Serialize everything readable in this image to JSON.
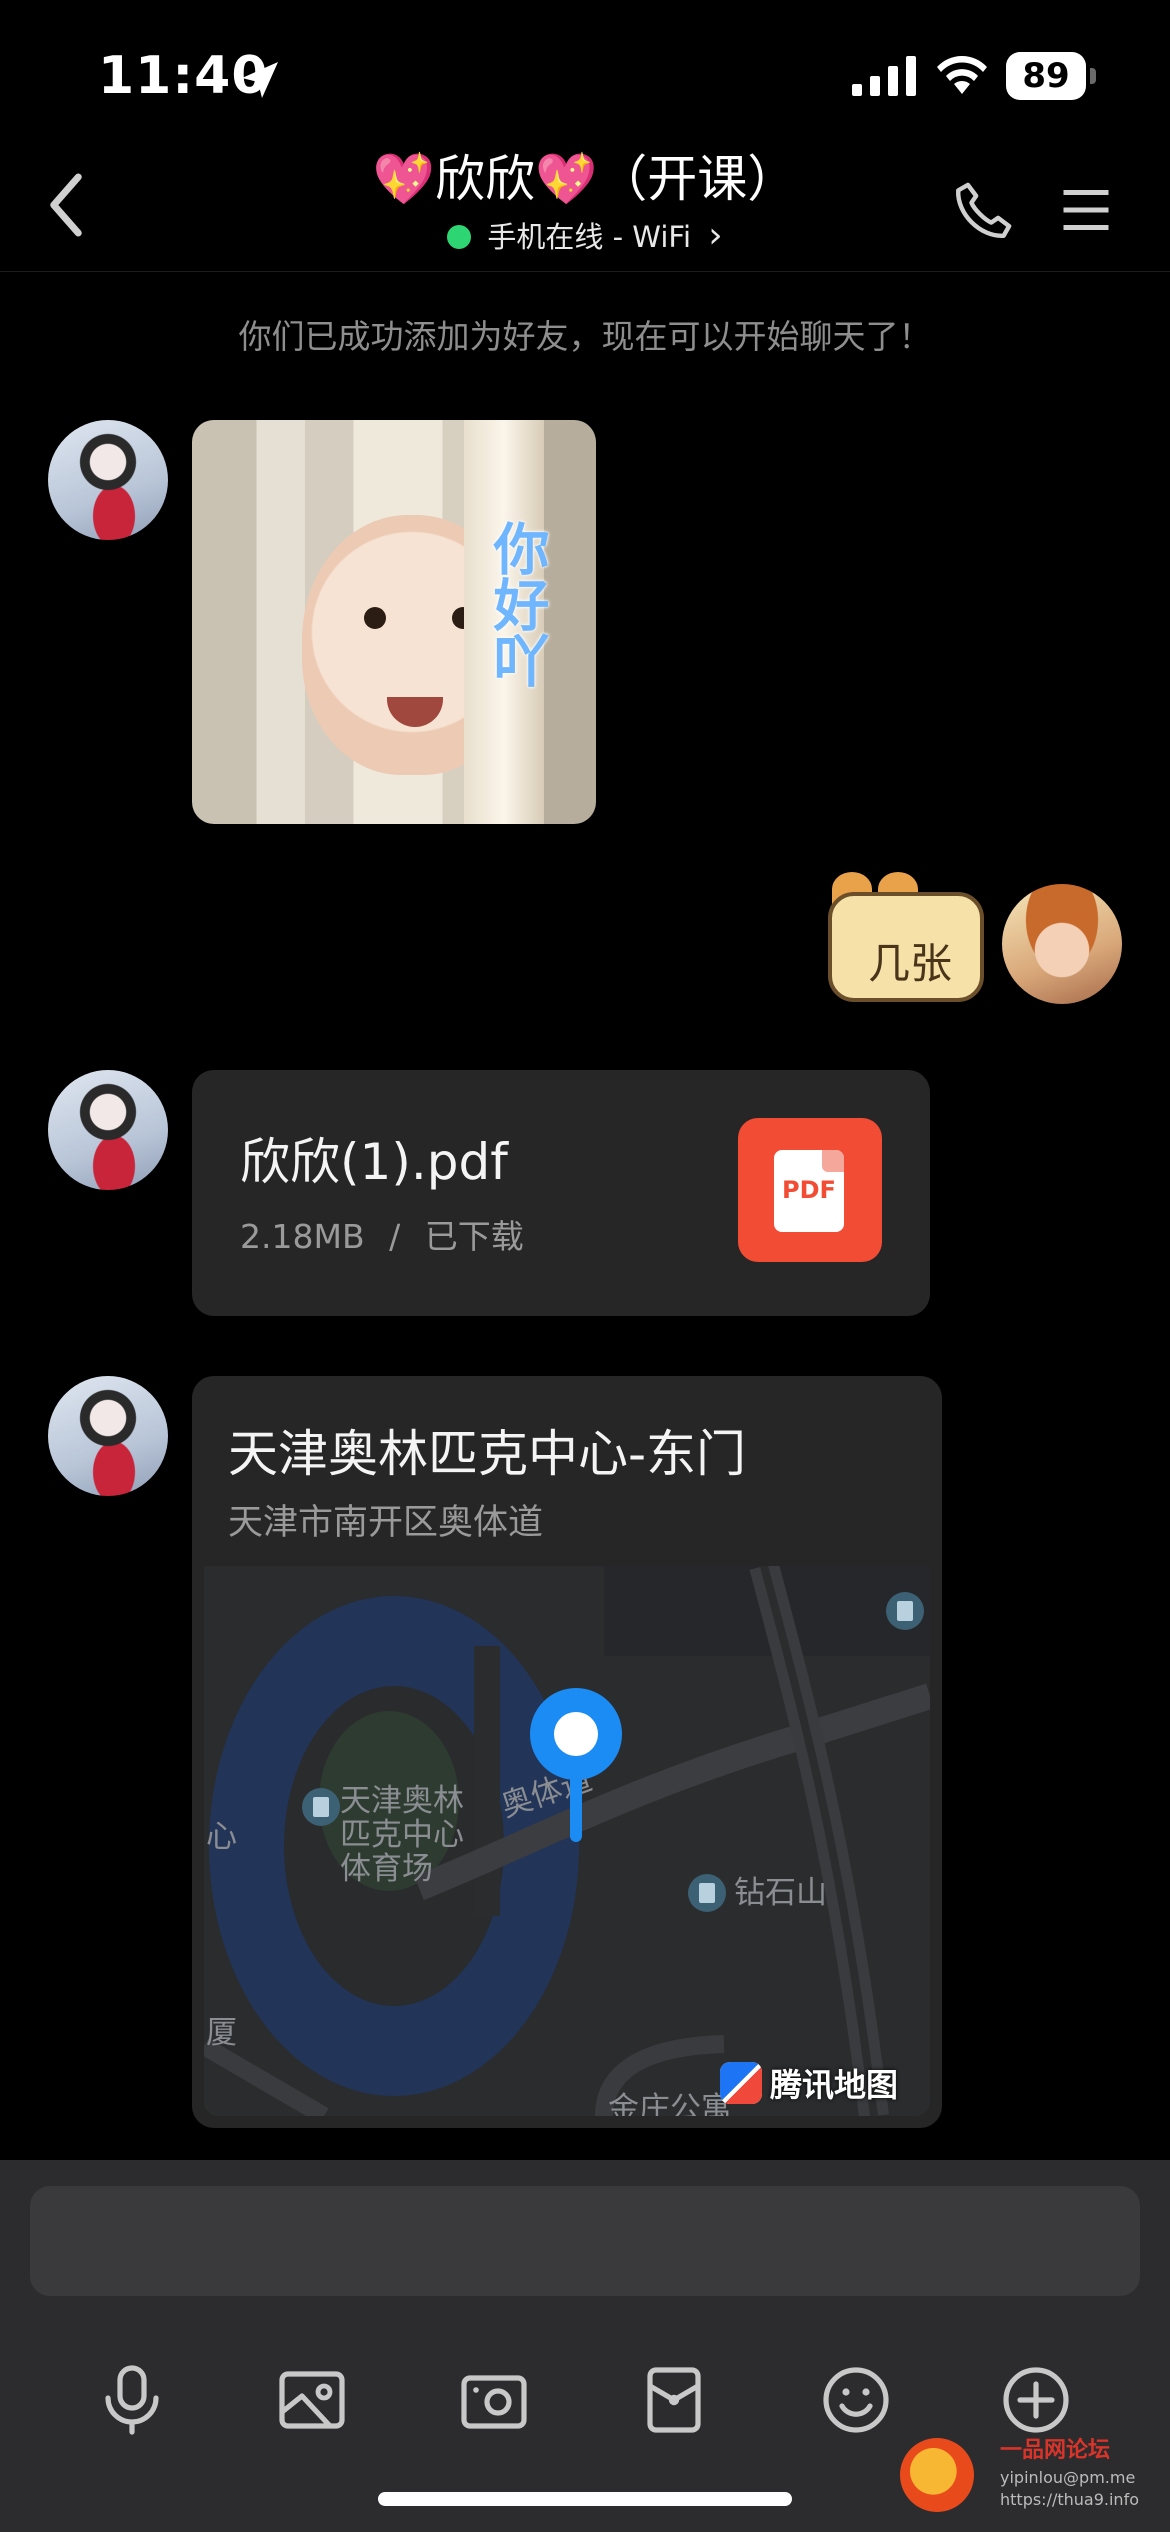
{
  "status_bar": {
    "time": "11:40",
    "battery": "89"
  },
  "header": {
    "title": "💖欣欣💖（开课）",
    "status": "手机在线 - WiFi",
    "status_chevron": "›",
    "online_color": "#2ed573"
  },
  "chat": {
    "system_note": "你们已成功添加为好友，现在可以开始聊天了！",
    "sticker_text": "你好吖",
    "cat_sticker_text": "几张",
    "file": {
      "name": "欣欣(1).pdf",
      "size": "2.18MB",
      "separator": "/",
      "status": "已下载",
      "icon_label": "PDF"
    },
    "location": {
      "title": "天津奥林匹克中心-东门",
      "address": "天津市南开区奥体道",
      "map_labels": [
        "天津奥林匹克中心体育场",
        "奥体道",
        "钻石山",
        "心",
        "厦",
        "金庄公寓"
      ],
      "map_provider": "腾讯地图"
    }
  },
  "input": {
    "placeholder": ""
  },
  "toolbar": [
    "microphone-icon",
    "gallery-icon",
    "camera-icon",
    "red-packet-icon",
    "emoji-icon",
    "plus-icon"
  ],
  "watermark": {
    "title": "一品网论坛",
    "line1": "yipinlou@pm.me",
    "line2": "https://thua9.info"
  }
}
